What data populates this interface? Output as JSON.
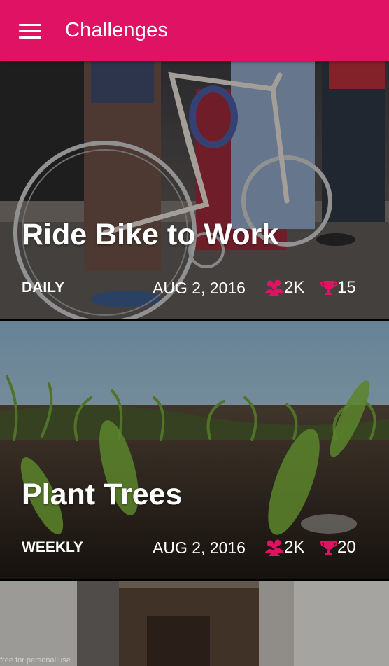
{
  "appbar": {
    "title": "Challenges",
    "menu_icon": "hamburger-menu-icon",
    "color": "#e01263"
  },
  "challenges": [
    {
      "title": "Ride Bike to Work",
      "frequency": "DAILY",
      "date": "AUG 2, 2016",
      "participants": "2K",
      "trophies": "15"
    },
    {
      "title": "Plant Trees",
      "frequency": "WEEKLY",
      "date": "AUG 2, 2016",
      "participants": "2K",
      "trophies": "20"
    }
  ],
  "icons": {
    "participants": "group-icon",
    "trophies": "trophy-icon",
    "accent": "#e01263"
  },
  "watermark": "free for personal use"
}
